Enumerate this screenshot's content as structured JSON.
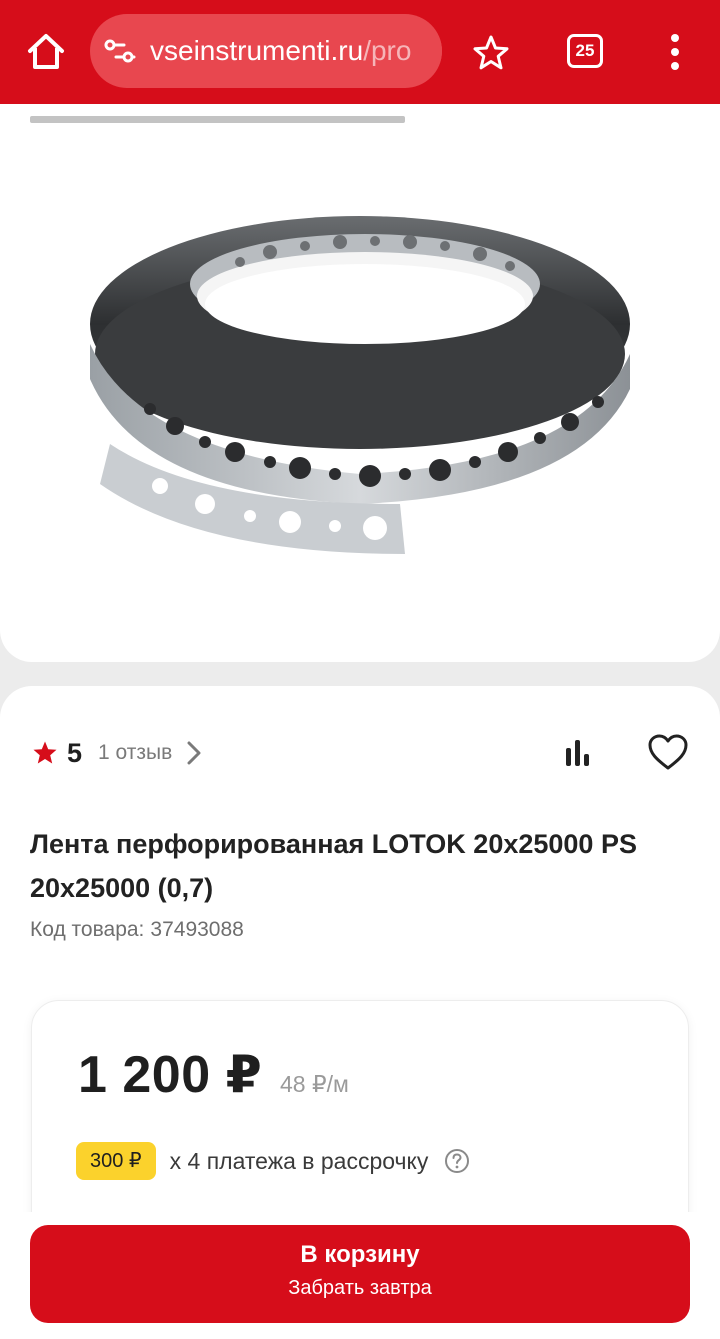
{
  "browser": {
    "url_domain": "vseinstrumenti.ru",
    "url_path": "/pro",
    "tab_count": "25",
    "theme_color": "#d60d1a",
    "icons": [
      "home-icon",
      "site-settings-icon",
      "star-icon",
      "tabs-icon",
      "more-vert-icon"
    ]
  },
  "gallery": {
    "progress": 0.52,
    "image": "perforated-mounting-tape-roll"
  },
  "product": {
    "rating": "5",
    "reviews_label": "1 отзыв",
    "title": "Лента перфорированная LOTOK 20х25000 PS 20х25000 (0,7)",
    "code_label": "Код товара:",
    "code_value": "37493088"
  },
  "price": {
    "main": "1 200 ₽",
    "per_unit": "48 ₽/м",
    "installment_amount": "300 ₽",
    "installment_text": "х 4 платежа в рассрочку"
  },
  "cart": {
    "label": "В корзину",
    "sublabel": "Забрать завтра"
  },
  "colors": {
    "accent": "#d60d1a",
    "badge": "#fbd22c"
  }
}
